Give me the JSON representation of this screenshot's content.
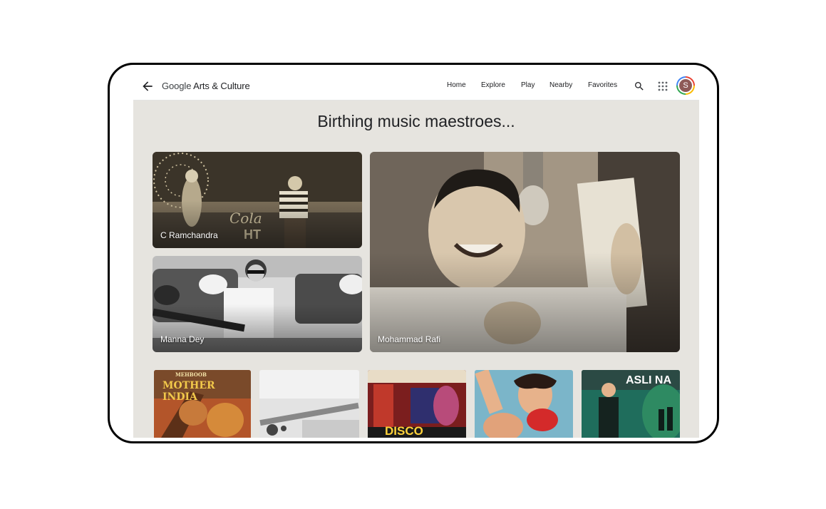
{
  "app": {
    "logo_google": "Google",
    "logo_rest": " Arts & Culture"
  },
  "nav": {
    "home": "Home",
    "explore": "Explore",
    "play": "Play",
    "nearby": "Nearby",
    "favorites": "Favorites"
  },
  "user": {
    "initial": "S"
  },
  "section": {
    "title": "Birthing music maestroes..."
  },
  "cards": [
    {
      "label": "C Ramchandra"
    },
    {
      "label": "Manna Dey"
    },
    {
      "label": "Mohammad Rafi"
    }
  ],
  "thumbnails": [
    {
      "text": "MOTHER INDIA",
      "small_text": "MEHBOOB"
    },
    {
      "text": ""
    },
    {
      "text": "DISCO"
    },
    {
      "text": ""
    },
    {
      "text": "ASLI NA"
    }
  ],
  "colors": {
    "accent": "#e6e4df",
    "text": "#202124"
  },
  "icons": [
    "arrow-back-icon",
    "search-icon",
    "apps-grid-icon"
  ]
}
